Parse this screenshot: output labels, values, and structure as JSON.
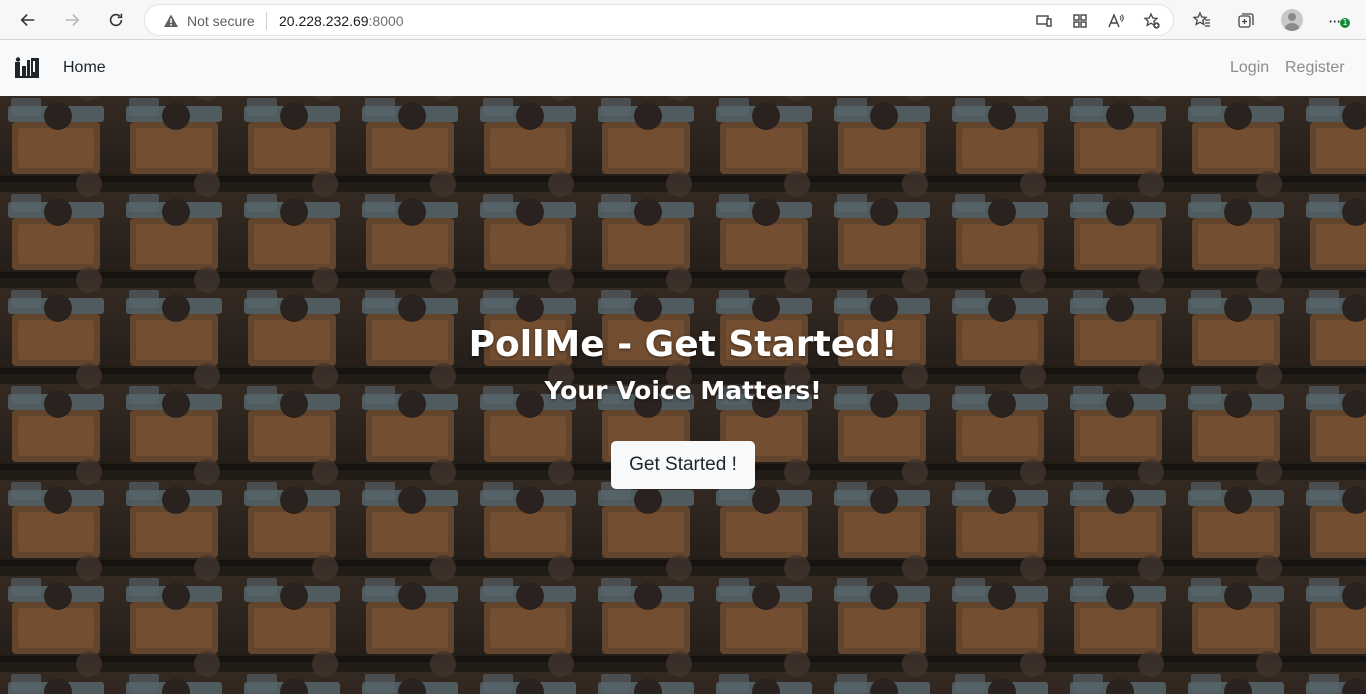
{
  "browser": {
    "security_label": "Not secure",
    "url_host": "20.228.232.69",
    "url_port": ":8000",
    "update_badge": "1",
    "icons": [
      "back-icon",
      "forward-icon",
      "reload-icon",
      "warning-icon",
      "install-app-icon",
      "apps-icon",
      "read-aloud-icon",
      "add-favorite-icon",
      "favorites-icon",
      "collections-icon",
      "profile-avatar",
      "more-icon"
    ]
  },
  "nav": {
    "home": "Home",
    "login": "Login",
    "register": "Register"
  },
  "hero": {
    "title": "PollMe - Get Started!",
    "subtitle": "Your Voice Matters!",
    "button": "Get Started !"
  },
  "colors": {
    "navbar_bg": "#f8f9fa",
    "nav_link_muted": "#8c8c8c",
    "hero_text": "#ffffff",
    "button_bg": "#f8f9fa"
  }
}
